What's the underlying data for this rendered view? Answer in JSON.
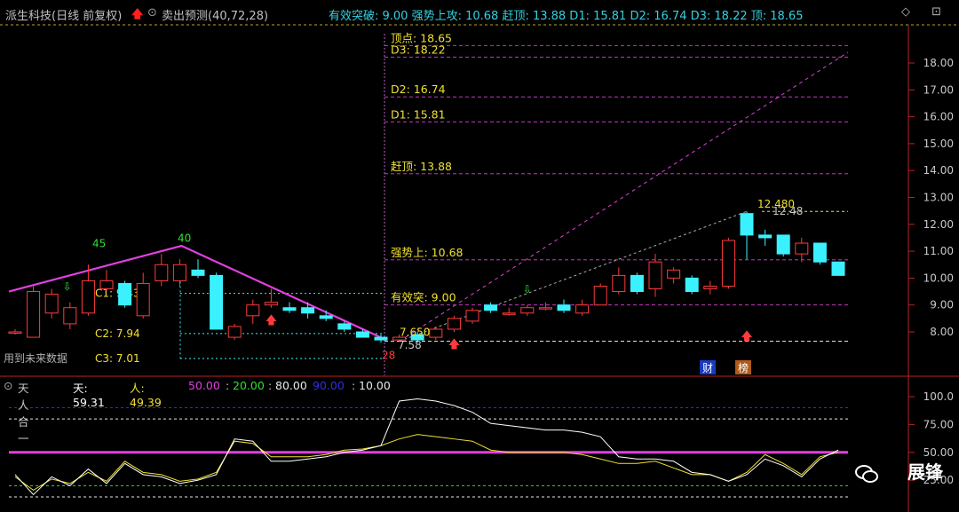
{
  "header": {
    "stock_title": "派生科技(日线 前复权)",
    "up_arrow": "🡅",
    "formula_name": "卖出预测(40,72,28)",
    "indicator_line": "有效突破: 9.00  强势上攻: 10.68  赶顶: 13.88  D1: 15.81  D2: 16.74  D3: 18.22  顶: 18.65",
    "right_icons": "◇ ⊡"
  },
  "price_axis": {
    "ticks": [
      "18.00",
      "17.00",
      "16.00",
      "15.00",
      "14.00",
      "13.00",
      "12.00",
      "11.00",
      "10.00",
      "9.00",
      "8.00"
    ],
    "min": 7.0,
    "max": 19.3
  },
  "levels": [
    {
      "label": "顶点: 18.65",
      "value": 18.65,
      "color": "#e040e0"
    },
    {
      "label": "D3: 18.22",
      "value": 18.22,
      "color": "#e040e0"
    },
    {
      "label": "D2: 16.74",
      "value": 16.74,
      "color": "#e040e0"
    },
    {
      "label": "D1: 15.81",
      "value": 15.81,
      "color": "#e040e0"
    },
    {
      "label": "赶顶: 13.88",
      "value": 13.88,
      "color": "#e040e0"
    },
    {
      "label": "强势上: 10.68",
      "value": 10.68,
      "color": "#e040e0"
    },
    {
      "label": "有效突: 9.00",
      "value": 9.0,
      "color": "#e040e0"
    }
  ],
  "left_annotations": {
    "c1": "C1: 9.43",
    "c2": "C2: 7.94",
    "c3": "C3: 7.01",
    "future_note": "用到未来数据",
    "high_left": "45",
    "high_peak": "40",
    "low_label": "28",
    "low_price": "7.58",
    "low_price2": "7.650",
    "recent_high": "12.480",
    "recent_high2": "12.48"
  },
  "badges": {
    "cai": "财",
    "bang": "榜"
  },
  "candles": [
    {
      "o": 8.0,
      "c": 8.0,
      "h": 8.1,
      "l": 7.9
    },
    {
      "o": 7.8,
      "c": 9.5,
      "h": 9.7,
      "l": 7.8
    },
    {
      "o": 8.7,
      "c": 9.4,
      "h": 9.6,
      "l": 8.5
    },
    {
      "o": 8.3,
      "c": 8.9,
      "h": 9.1,
      "l": 8.1
    },
    {
      "o": 8.7,
      "c": 9.9,
      "h": 10.5,
      "l": 8.6
    },
    {
      "o": 9.6,
      "c": 9.9,
      "h": 10.3,
      "l": 9.5
    },
    {
      "o": 9.8,
      "c": 9.0,
      "h": 9.9,
      "l": 8.9
    },
    {
      "o": 8.6,
      "c": 9.8,
      "h": 10.2,
      "l": 8.5
    },
    {
      "o": 9.9,
      "c": 10.5,
      "h": 10.9,
      "l": 9.7
    },
    {
      "o": 9.9,
      "c": 10.5,
      "h": 10.7,
      "l": 9.7
    },
    {
      "o": 10.3,
      "c": 10.1,
      "h": 10.7,
      "l": 10.0
    },
    {
      "o": 10.1,
      "c": 8.1,
      "h": 10.2,
      "l": 8.1
    },
    {
      "o": 7.8,
      "c": 8.2,
      "h": 8.3,
      "l": 7.7
    },
    {
      "o": 8.6,
      "c": 9.0,
      "h": 9.2,
      "l": 8.3
    },
    {
      "o": 9.0,
      "c": 9.1,
      "h": 9.6,
      "l": 8.9
    },
    {
      "o": 8.9,
      "c": 8.8,
      "h": 9.1,
      "l": 8.7
    },
    {
      "o": 8.9,
      "c": 8.7,
      "h": 9.1,
      "l": 8.5
    },
    {
      "o": 8.6,
      "c": 8.5,
      "h": 8.8,
      "l": 8.4
    },
    {
      "o": 8.3,
      "c": 8.1,
      "h": 8.4,
      "l": 8.0
    },
    {
      "o": 8.0,
      "c": 7.8,
      "h": 8.1,
      "l": 7.8
    },
    {
      "o": 7.8,
      "c": 7.7,
      "h": 7.9,
      "l": 7.6
    },
    {
      "o": 7.7,
      "c": 7.8,
      "h": 7.9,
      "l": 7.65
    },
    {
      "o": 7.9,
      "c": 7.7,
      "h": 8.0,
      "l": 7.6
    },
    {
      "o": 7.8,
      "c": 8.1,
      "h": 8.2,
      "l": 7.7
    },
    {
      "o": 8.1,
      "c": 8.5,
      "h": 8.6,
      "l": 8.0
    },
    {
      "o": 8.4,
      "c": 8.8,
      "h": 8.9,
      "l": 8.3
    },
    {
      "o": 9.0,
      "c": 8.8,
      "h": 9.1,
      "l": 8.7
    },
    {
      "o": 8.7,
      "c": 8.7,
      "h": 8.9,
      "l": 8.6
    },
    {
      "o": 8.7,
      "c": 8.9,
      "h": 9.0,
      "l": 8.6
    },
    {
      "o": 8.9,
      "c": 8.9,
      "h": 9.1,
      "l": 8.8
    },
    {
      "o": 9.0,
      "c": 8.8,
      "h": 9.2,
      "l": 8.7
    },
    {
      "o": 8.7,
      "c": 9.0,
      "h": 9.2,
      "l": 8.6
    },
    {
      "o": 9.0,
      "c": 9.7,
      "h": 9.8,
      "l": 9.0
    },
    {
      "o": 9.5,
      "c": 10.1,
      "h": 10.4,
      "l": 9.4
    },
    {
      "o": 10.1,
      "c": 9.5,
      "h": 10.2,
      "l": 9.4
    },
    {
      "o": 9.6,
      "c": 10.6,
      "h": 10.9,
      "l": 9.3
    },
    {
      "o": 10.0,
      "c": 10.3,
      "h": 10.4,
      "l": 9.8
    },
    {
      "o": 10.0,
      "c": 9.5,
      "h": 10.1,
      "l": 9.4
    },
    {
      "o": 9.6,
      "c": 9.7,
      "h": 9.9,
      "l": 9.4
    },
    {
      "o": 9.7,
      "c": 11.4,
      "h": 11.5,
      "l": 9.6
    },
    {
      "o": 12.4,
      "c": 11.6,
      "h": 12.48,
      "l": 10.7
    },
    {
      "o": 11.6,
      "c": 11.5,
      "h": 11.8,
      "l": 11.2
    },
    {
      "o": 11.6,
      "c": 10.9,
      "h": 11.6,
      "l": 10.8
    },
    {
      "o": 10.9,
      "c": 11.3,
      "h": 11.5,
      "l": 10.6
    },
    {
      "o": 11.3,
      "c": 10.6,
      "h": 11.3,
      "l": 10.5
    },
    {
      "o": 10.6,
      "c": 10.1,
      "h": 10.6,
      "l": 10.1
    }
  ],
  "sub_indicator": {
    "title": "天人合一",
    "tian_label": "天: 59.31",
    "ren_label": "人: 49.39",
    "p50": "50.00",
    "p20": "20.00",
    "p80": "80.00",
    "p90": "90.00",
    "p10": "10.00",
    "ticks": [
      "100.0",
      "75.00",
      "50.00",
      "25.00"
    ],
    "tian": [
      30,
      12,
      28,
      20,
      35,
      22,
      40,
      30,
      28,
      22,
      25,
      30,
      62,
      60,
      42,
      42,
      44,
      46,
      50,
      52,
      56,
      96,
      98,
      96,
      92,
      86,
      76,
      74,
      72,
      70,
      70,
      68,
      64,
      46,
      44,
      44,
      42,
      32,
      30,
      24,
      30,
      44,
      38,
      28,
      44,
      52
    ],
    "ren": [
      28,
      16,
      26,
      22,
      32,
      24,
      42,
      32,
      30,
      24,
      26,
      32,
      60,
      58,
      46,
      46,
      46,
      48,
      52,
      53,
      56,
      62,
      66,
      64,
      62,
      60,
      52,
      50,
      50,
      50,
      50,
      48,
      44,
      40,
      40,
      42,
      36,
      30,
      30,
      24,
      32,
      48,
      40,
      30,
      46,
      50
    ]
  },
  "watermark": {
    "text": "展锋"
  },
  "colors": {
    "bull": "#ff3b3b",
    "bear": "#3af2ff",
    "level": "#e040e0",
    "label_yellow": "#f0e030",
    "axis": "#c02020"
  }
}
